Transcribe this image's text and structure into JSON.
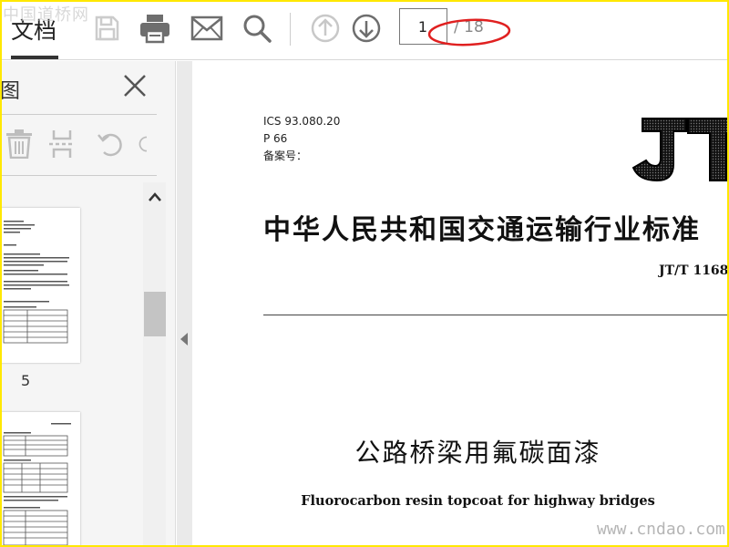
{
  "watermarks": {
    "top": "中国道桥网",
    "bottom": "www.cndao.com"
  },
  "toolbar": {
    "doc_tab": "文档",
    "icons": [
      "save-icon",
      "print-icon",
      "mail-icon",
      "search-icon",
      "arrow-up-circle-icon",
      "arrow-down-circle-icon"
    ],
    "page_current": "1",
    "page_total": "/ 18"
  },
  "annotation": {
    "color": "#e02020"
  },
  "sidebar": {
    "title": "图",
    "tools": [
      "trash-icon",
      "extract-pages-icon",
      "rotate-left-icon",
      "rotate-right-icon"
    ],
    "thumbnail_labels": [
      "5"
    ]
  },
  "document": {
    "ics_lines": [
      "ICS 93.080.20",
      "P 66",
      "备案号："
    ],
    "logo": "JT",
    "standard_title": "中华人民共和国交通运输行业标准",
    "standard_code": "JT/T 1168",
    "cn_title": "公路桥梁用氟碳面漆",
    "en_title": "Fluorocarbon resin topcoat for highway bridges"
  },
  "colors": {
    "accent_border": "#ffe800",
    "icon_gray": "#6e6e6e",
    "icon_disabled": "#cccccc"
  }
}
